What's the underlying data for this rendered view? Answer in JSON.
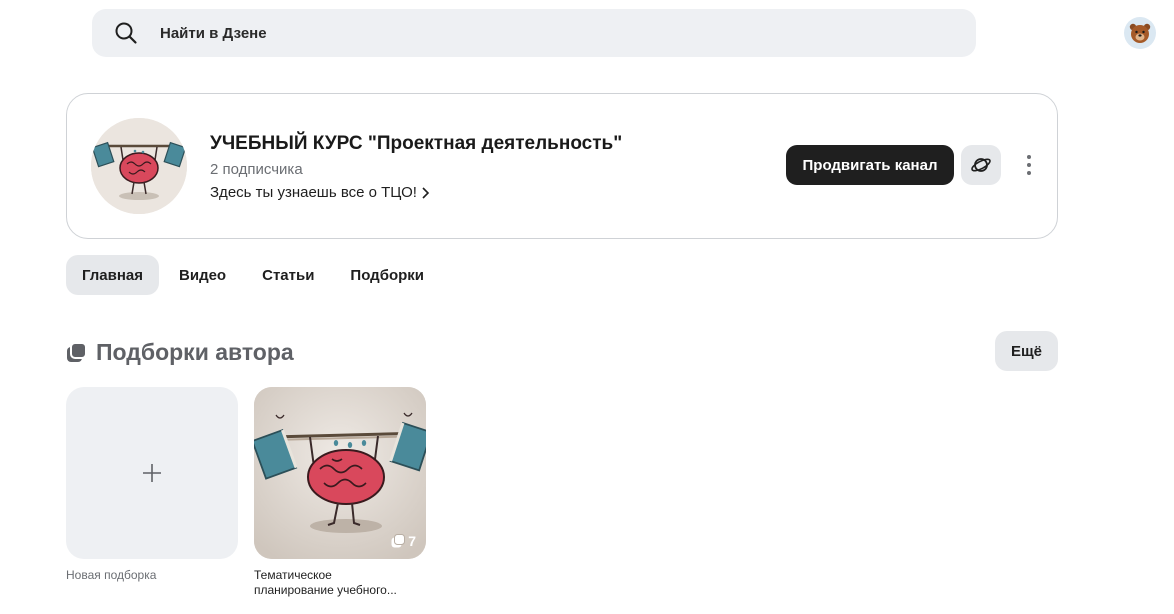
{
  "search": {
    "placeholder": "Найти в Дзене"
  },
  "channel": {
    "title": "УЧЕБНЫЙ КУРС \"Проектная деятельность\"",
    "subscribers": "2 подписчика",
    "description": "Здесь ты узнаешь все о ТЦО!",
    "promote_label": "Продвигать канал"
  },
  "tabs": [
    {
      "label": "Главная",
      "active": true
    },
    {
      "label": "Видео"
    },
    {
      "label": "Статьи"
    },
    {
      "label": "Подборки"
    }
  ],
  "section": {
    "title": "Подборки автора",
    "more_label": "Ещё"
  },
  "cards": {
    "new_label": "Новая подборка",
    "collection": {
      "count": "7",
      "title_line1": "Тематическое",
      "title_line2": "планирование учебного..."
    }
  },
  "icons": {
    "search": "search-icon",
    "avatar": "bear-avatar-icon",
    "planet": "planet-icon",
    "more": "more-vertical-icon",
    "collections": "collections-icon",
    "plus": "plus-icon",
    "brain": "brain-lifting-books-image"
  },
  "colors": {
    "search_bg": "#eef0f3",
    "button_dark": "#1f1f1f",
    "tab_active_bg": "#e6e8eb",
    "muted_text": "#6b6e73"
  }
}
